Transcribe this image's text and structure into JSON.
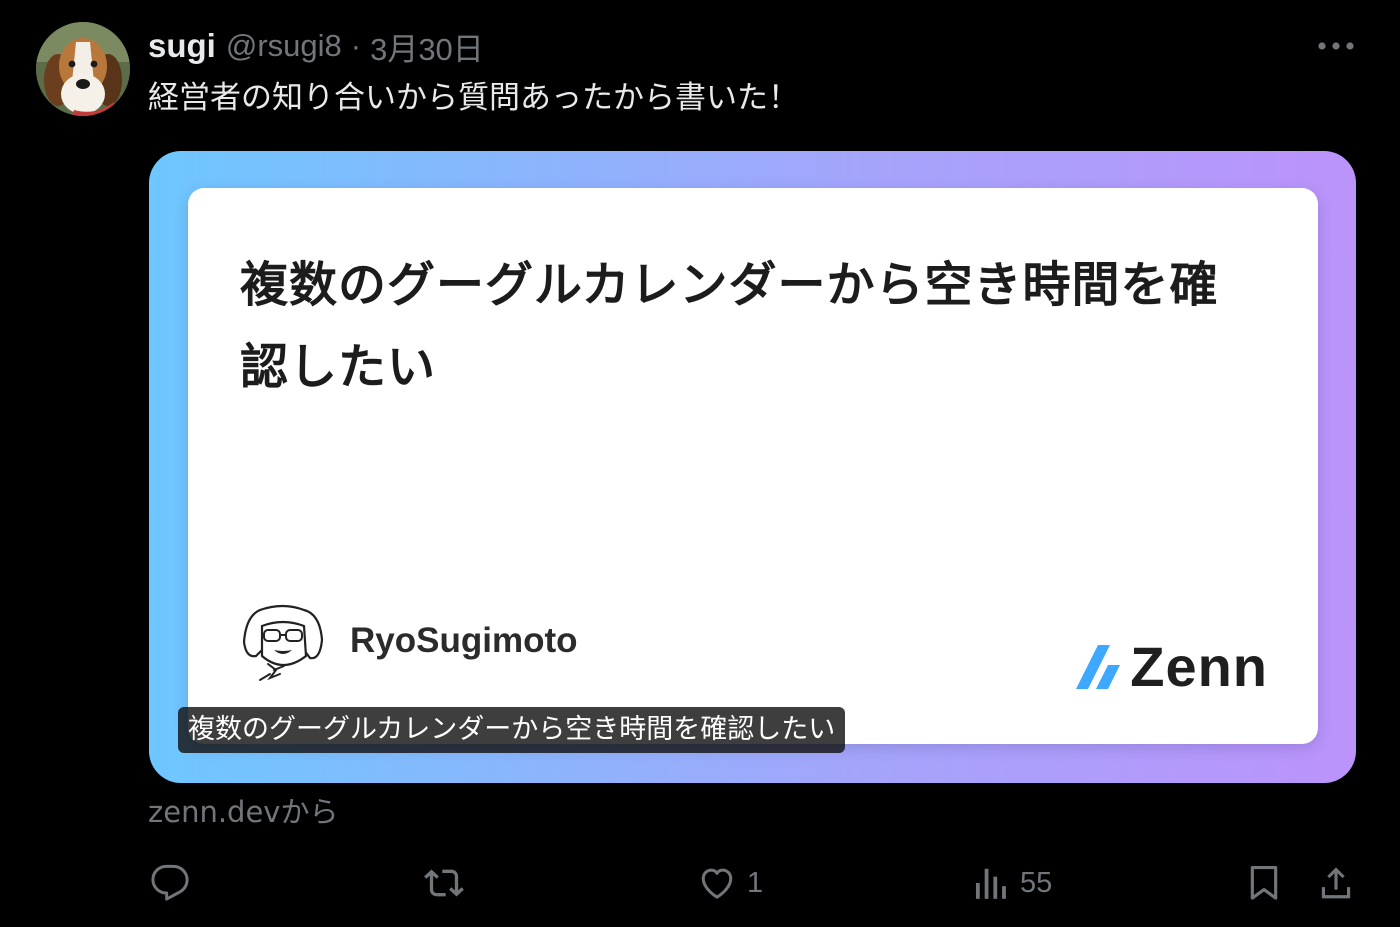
{
  "tweet": {
    "author": {
      "display_name": "sugi",
      "handle": "@rsugi8",
      "separator": "·",
      "date": "3月30日"
    },
    "text": "経営者の知り合いから質問あったから書いた！",
    "more_icon": "more-horizontal-icon"
  },
  "card": {
    "title": "複数のグーグルカレンダーから空き時間を確認したい",
    "author_name": "RyoSugimoto",
    "brand": "Zenn",
    "caption": "複数のグーグルカレンダーから空き時間を確認したい",
    "source": "zenn.devから",
    "gradient_colors": [
      "#6ec7ff",
      "#a5a4fb",
      "#bb93fb"
    ],
    "zenn_accent": "#3ea8ff"
  },
  "actions": {
    "reply": {
      "icon": "reply-icon",
      "count": ""
    },
    "repost": {
      "icon": "repost-icon",
      "count": ""
    },
    "like": {
      "icon": "heart-icon",
      "count": "1"
    },
    "views": {
      "icon": "views-chart-icon",
      "count": "55"
    },
    "bookmark": {
      "icon": "bookmark-icon"
    },
    "share": {
      "icon": "share-icon"
    }
  },
  "colors": {
    "background": "#000000",
    "text_primary": "#e7e9ea",
    "text_secondary": "#71767b"
  }
}
